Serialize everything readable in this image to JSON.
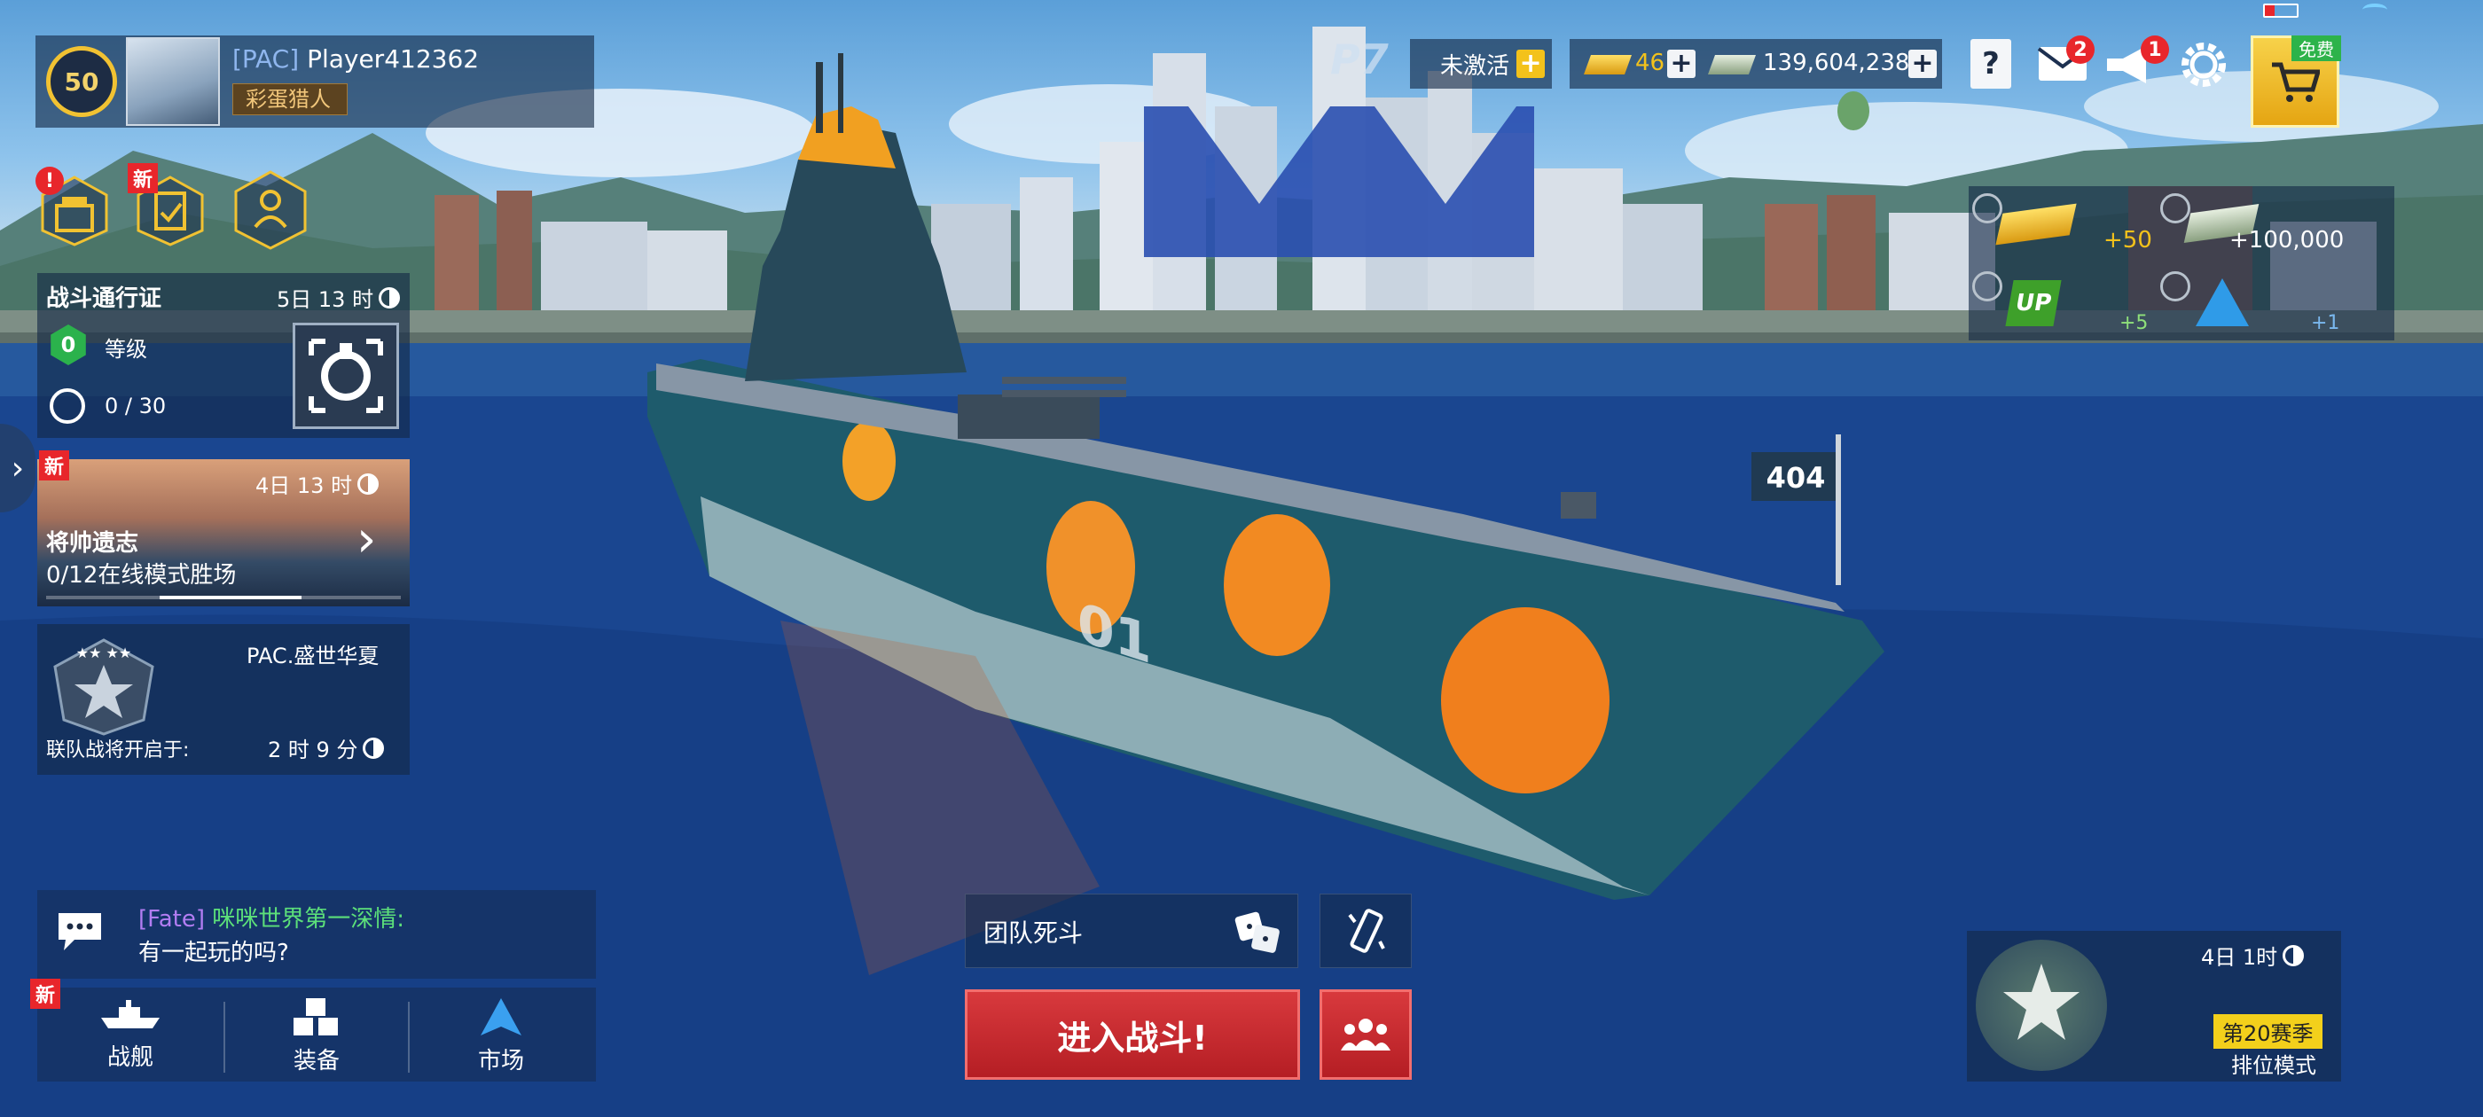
{
  "player": {
    "level": "50",
    "clan_tag": "[PAC]",
    "name": "Player412362",
    "title": "彩蛋猎人"
  },
  "top": {
    "vip_status": "未激活",
    "gold": "46",
    "silver": "139,604,238",
    "mail_badge": "2",
    "notice_badge": "1",
    "shop_tag": "免费"
  },
  "rewards": {
    "gold": "+50",
    "silver": "+100,000",
    "up": "+5",
    "boost": "+1"
  },
  "battle_pass": {
    "title": "战斗通行证",
    "timer": "5日 13 时",
    "level": "0",
    "level_label": "等级",
    "progress": "0 / 30"
  },
  "event": {
    "new_tag": "新",
    "timer": "4日 13 时",
    "title": "将帅遗志",
    "progress": "0/12在线模式胜场"
  },
  "clan": {
    "name": "PAC.盛世华夏",
    "label": "联队战将开启于:",
    "timer": "2 时 9 分"
  },
  "chat": {
    "tag": "[Fate]",
    "user": "咪咪世界第一深情:",
    "message": "有一起玩的吗?"
  },
  "nav": {
    "new_tag": "新",
    "items": [
      "战舰",
      "装备",
      "市场"
    ]
  },
  "battle": {
    "mode": "团队死斗",
    "enter": "进入战斗!"
  },
  "ranked": {
    "timer": "4日 1时",
    "season": "第20赛季",
    "mode": "排位模式"
  },
  "ship": {
    "flag": "404",
    "hull_number": "01"
  },
  "colors": {
    "accent_red": "#c7252c",
    "gold": "#f3c21b",
    "panel": "#14284a"
  }
}
